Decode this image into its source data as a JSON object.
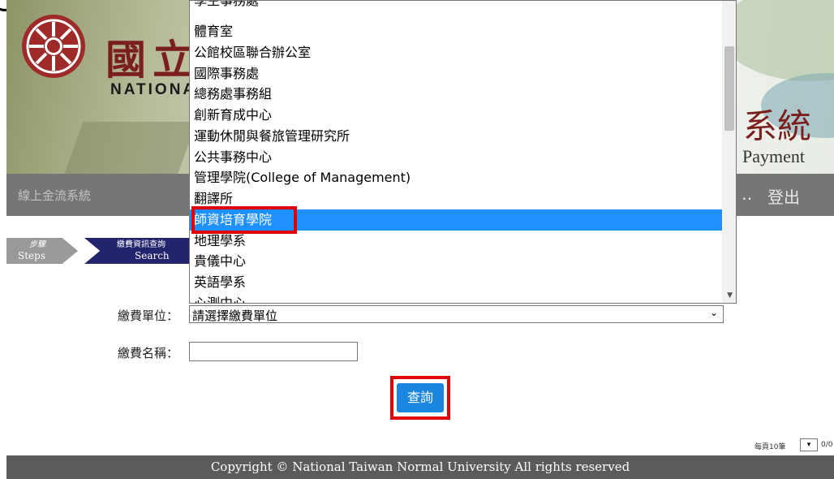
{
  "banner": {
    "title_zh": "國立",
    "title_en": "NATIONAL",
    "system_zh": "系統",
    "system_en": "Payment"
  },
  "nav": {
    "home": "線上金流系統",
    "extra": "‥",
    "logout": "登出"
  },
  "steps": {
    "step1_zh": "步驟",
    "step1_en": "Steps",
    "step2_zh": "繳費資訊查詢",
    "step2_en": "Search"
  },
  "form": {
    "unit_label": "繳費單位：",
    "unit_value": "請選擇繳費單位",
    "name_label": "繳費名稱：",
    "name_value": "",
    "query_button": "查詢"
  },
  "dropdown": {
    "options": [
      "學生事務處",
      "體育室",
      "公館校區聯合辦公室",
      "國際事務處",
      "總務處事務組",
      "創新育成中心",
      "運動休閒與餐旅管理研究所",
      "公共事務中心",
      "管理學院(College of Management)",
      "翻譯所",
      "師資培育學院",
      "地理學系",
      "貴儀中心",
      "英語學系",
      "心測中心"
    ],
    "selected": "師資培育學院",
    "selected_color": "#1e90ff"
  },
  "pager": {
    "per_page": "每頁10筆",
    "value": "0/0"
  },
  "footer": {
    "copyright": "Copyright © National Taiwan Normal University All rights reserved"
  },
  "colors": {
    "highlight_frame": "#e00000",
    "button": "#1a86e0",
    "navbar": "#767676",
    "footer": "#5b5b5b",
    "brand": "#7a1e1e"
  }
}
